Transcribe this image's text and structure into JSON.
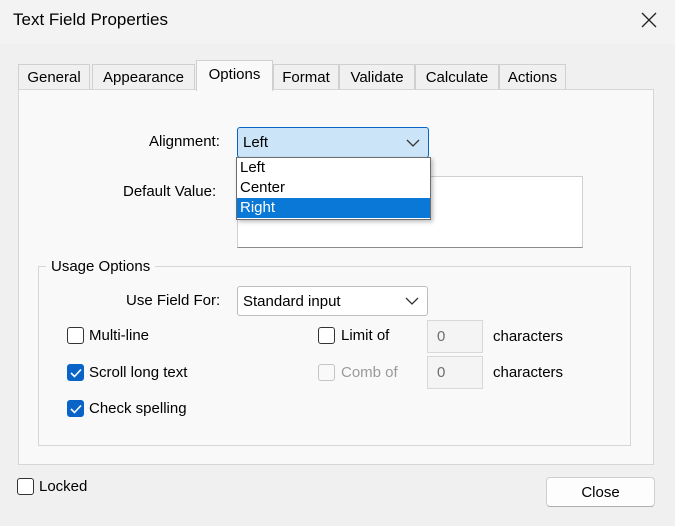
{
  "window": {
    "title": "Text Field Properties"
  },
  "tabs": [
    {
      "label": "General"
    },
    {
      "label": "Appearance"
    },
    {
      "label": "Options"
    },
    {
      "label": "Format"
    },
    {
      "label": "Validate"
    },
    {
      "label": "Calculate"
    },
    {
      "label": "Actions"
    }
  ],
  "active_tab": "Options",
  "options": {
    "alignment_label": "Alignment:",
    "alignment_value": "Left",
    "alignment_options": [
      {
        "label": "Left"
      },
      {
        "label": "Center"
      },
      {
        "label": "Right"
      }
    ],
    "alignment_highlighted": "Right",
    "default_value_label": "Default Value:",
    "default_value": ""
  },
  "usage": {
    "legend": "Usage Options",
    "use_field_for_label": "Use Field For:",
    "use_field_for_value": "Standard input",
    "multiline_label": "Multi-line",
    "multiline_checked": false,
    "scroll_label": "Scroll long text",
    "scroll_checked": true,
    "spelling_label": "Check spelling",
    "spelling_checked": true,
    "limit_label": "Limit of",
    "limit_checked": false,
    "limit_value": "0",
    "limit_units": "characters",
    "comb_label": "Comb of",
    "comb_checked": false,
    "comb_enabled": false,
    "comb_value": "0",
    "comb_units": "characters"
  },
  "footer": {
    "locked_label": "Locked",
    "locked_checked": false,
    "close_label": "Close"
  },
  "colors": {
    "accent": "#0a64c8",
    "highlight": "#0a78d7",
    "focus_bg": "#cce4f7"
  },
  "icons": [
    "close-icon",
    "chevron-down-icon",
    "checkmark-icon"
  ]
}
